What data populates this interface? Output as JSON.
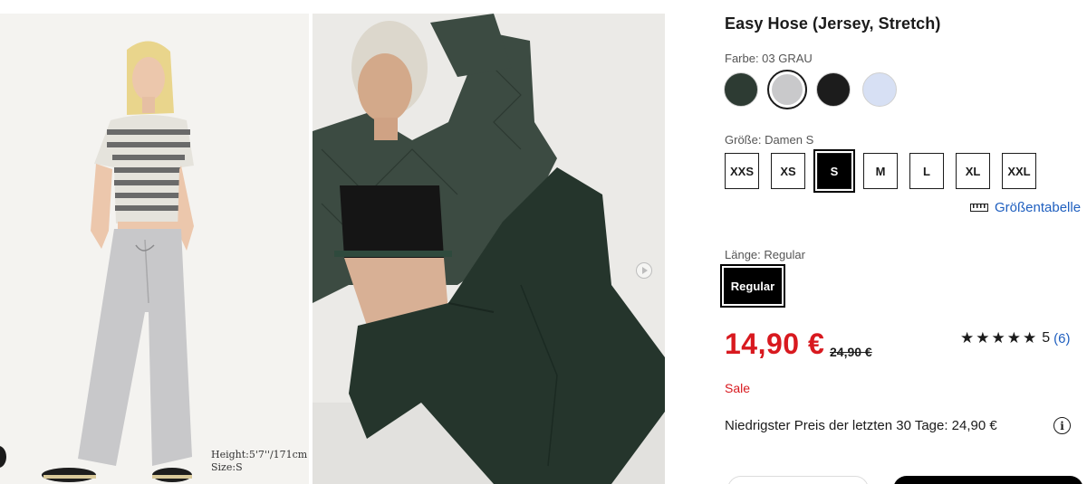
{
  "gallery": {
    "model_caption_height": "Height:5'7''/171cm",
    "model_caption_size": "Size:S"
  },
  "product": {
    "title": "Easy Hose (Jersey, Stretch)",
    "color_label": "Farbe: 03 GRAU",
    "colors": [
      {
        "name": "dark-green",
        "hex": "#2d3b33",
        "selected": false
      },
      {
        "name": "grey",
        "hex": "#c9c9cb",
        "selected": true
      },
      {
        "name": "black",
        "hex": "#1c1c1c",
        "selected": false
      },
      {
        "name": "light-blue",
        "hex": "#d7e0f4",
        "selected": false
      }
    ],
    "size_label": "Größe: Damen S",
    "sizes": [
      "XXS",
      "XS",
      "S",
      "M",
      "L",
      "XL",
      "XXL"
    ],
    "selected_size": "S",
    "size_chart_link": "Größentabelle",
    "length_label": "Länge: Regular",
    "length_option": "Regular",
    "price": "14,90 €",
    "old_price": "24,90 €",
    "rating_stars": "★★★★★",
    "rating_value": "5",
    "rating_count": "(6)",
    "sale_label": "Sale",
    "lowest_price_text": "Niedrigster Preis der letzten 30 Tage: 24,90 €",
    "info_icon": "i"
  },
  "colors": {
    "price_red": "#d8191f",
    "link_blue": "#1f5fbf"
  }
}
